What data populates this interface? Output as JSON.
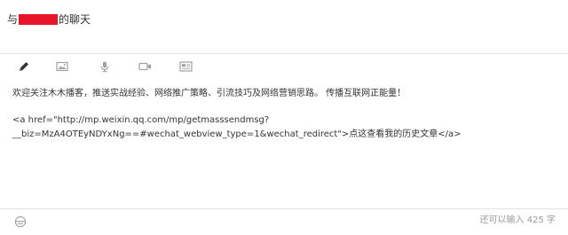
{
  "chat": {
    "title_prefix": "与",
    "title_suffix": "的聊天"
  },
  "toolbar": {
    "tools": [
      {
        "name": "text-tool",
        "icon": "pencil-icon"
      },
      {
        "name": "image-tool",
        "icon": "image-icon"
      },
      {
        "name": "voice-tool",
        "icon": "microphone-icon"
      },
      {
        "name": "video-tool",
        "icon": "video-camera-icon"
      },
      {
        "name": "news-tool",
        "icon": "article-card-icon"
      }
    ]
  },
  "editor": {
    "line1": "欢迎关注木木播客，推送实战经验、网络推广策略、引流技巧及网络营销思路。 传播互联网正能量！",
    "line2": "<a href=\"http://mp.weixin.qq.com/mp/getmasssendmsg?__biz=MzA4OTEyNDYxNg==#wechat_webview_type=1&wechat_redirect\">点这查看我的历史文章</a>"
  },
  "footer": {
    "emoji_icon": "smiley-face-icon",
    "counter_text": "还可以输入 425 字"
  },
  "colors": {
    "redaction": "#e8152a",
    "icon_gray": "#a0a0a0",
    "icon_active": "#333333"
  }
}
